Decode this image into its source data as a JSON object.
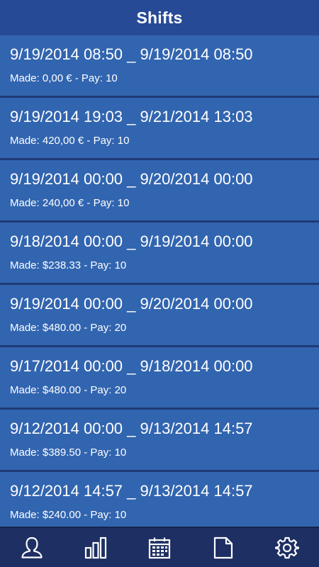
{
  "header": {
    "title": "Shifts"
  },
  "shifts": [
    {
      "range": "9/19/2014 08:50 _ 9/19/2014 08:50",
      "detail": "Made: 0,00 € - Pay: 10"
    },
    {
      "range": "9/19/2014 19:03 _ 9/21/2014 13:03",
      "detail": "Made: 420,00 € - Pay: 10"
    },
    {
      "range": "9/19/2014 00:00 _ 9/20/2014 00:00",
      "detail": "Made: 240,00 € - Pay: 10"
    },
    {
      "range": "9/18/2014 00:00 _ 9/19/2014 00:00",
      "detail": "Made: $238.33 - Pay: 10"
    },
    {
      "range": "9/19/2014 00:00 _ 9/20/2014 00:00",
      "detail": "Made: $480.00 - Pay: 20"
    },
    {
      "range": "9/17/2014 00:00 _ 9/18/2014 00:00",
      "detail": "Made: $480.00 - Pay: 20"
    },
    {
      "range": "9/12/2014 00:00 _ 9/13/2014 14:57",
      "detail": "Made: $389.50 - Pay: 10"
    },
    {
      "range": "9/12/2014 14:57 _ 9/13/2014 14:57",
      "detail": "Made: $240.00 - Pay: 10"
    }
  ],
  "nav": [
    {
      "icon": "user-icon"
    },
    {
      "icon": "bar-chart-icon"
    },
    {
      "icon": "calendar-icon"
    },
    {
      "icon": "document-icon"
    },
    {
      "icon": "gear-icon"
    }
  ],
  "colors": {
    "header": "#274a97",
    "item": "#3265b0",
    "separator": "#1f3a77",
    "nav": "#1d2f63",
    "text": "#ffffff"
  }
}
